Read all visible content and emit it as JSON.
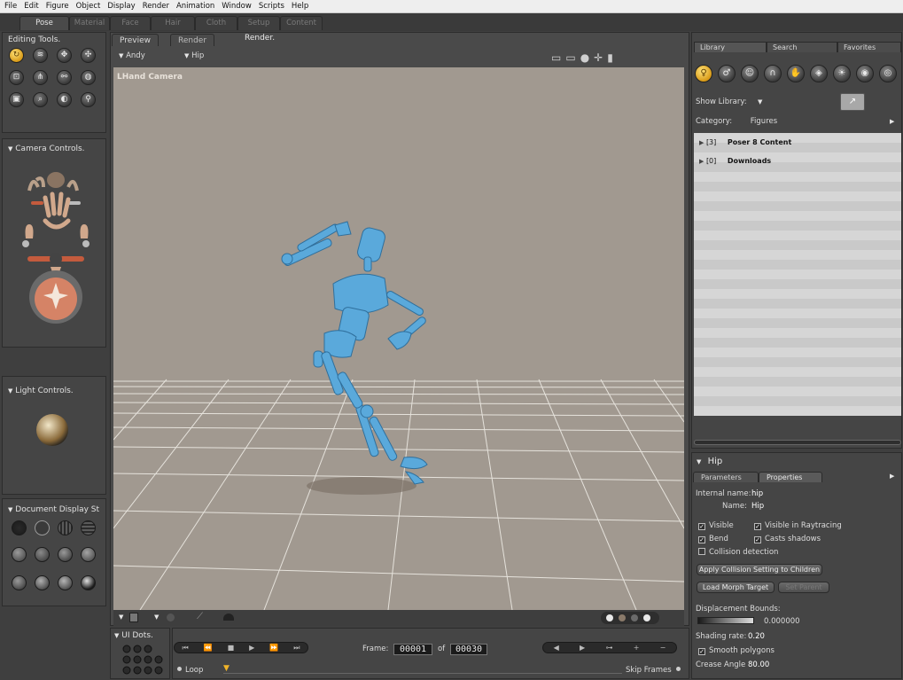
{
  "menu": [
    "File",
    "Edit",
    "Figure",
    "Object",
    "Display",
    "Render",
    "Animation",
    "Window",
    "Scripts",
    "Help"
  ],
  "room_tabs": [
    {
      "label": "Pose",
      "active": true
    },
    {
      "label": "Material",
      "active": false
    },
    {
      "label": "Face",
      "active": false
    },
    {
      "label": "Hair",
      "active": false
    },
    {
      "label": "Cloth",
      "active": false
    },
    {
      "label": "Setup",
      "active": false
    },
    {
      "label": "Content",
      "active": false
    }
  ],
  "left": {
    "editing_title": "Editing Tools.",
    "camera_title": "Camera Controls.",
    "light_title": "Light Controls.",
    "document_title": "Document Display St"
  },
  "doc": {
    "tabs": {
      "preview": "Preview",
      "render": "Render",
      "render_btn": "Render."
    },
    "figure_select": "Andy",
    "actor_select": "Hip",
    "camera_label": "LHand Camera"
  },
  "bottom": {
    "ui_dots": "UI Dots.",
    "frame_label": "Frame:",
    "frame_value": "00001",
    "of_label": "of",
    "total_frames": "00030",
    "loop_label": "Loop",
    "skip_label": "Skip Frames"
  },
  "library": {
    "tabs": [
      "Library",
      "Search",
      "Favorites"
    ],
    "show_label": "Show Library:",
    "category_label": "Category:",
    "category_value": "Figures",
    "items": [
      {
        "count": "[3]",
        "name": "Poser 8 Content"
      },
      {
        "count": "[0]",
        "name": "Downloads"
      }
    ]
  },
  "params": {
    "title": "Hip",
    "tabs": [
      "Parameters",
      "Properties"
    ],
    "internal_name_label": "Internal name:",
    "internal_name": "hip",
    "name_label": "Name:",
    "name": "Hip",
    "visible": "Visible",
    "visible_raytracing": "Visible in Raytracing",
    "bend": "Bend",
    "casts_shadows": "Casts shadows",
    "collision": "Collision detection",
    "apply_btn": "Apply Collision Setting to Children",
    "load_morph_btn": "Load Morph Target",
    "set_parent_btn": "Set Parent",
    "displacement_label": "Displacement Bounds:",
    "displacement_value": "0.000000",
    "shading_label": "Shading rate:",
    "shading_value": "0.20",
    "smooth": "Smooth polygons",
    "crease_label": "Crease Angle",
    "crease_value": "80.00"
  },
  "icons": {
    "editing": [
      "rotate-icon",
      "twist-icon",
      "translate-icon",
      "translate-in-out-icon",
      "scale-icon",
      "taper-icon",
      "chain-break-icon",
      "color-icon",
      "grouping-icon",
      "view-magnifier-icon",
      "morphing-icon",
      "direct-manipulation-icon"
    ],
    "library": [
      "figures-icon",
      "poses-icon",
      "expression-icon",
      "hair-icon",
      "hands-icon",
      "props-icon",
      "lights-icon",
      "cameras-icon",
      "materials-icon"
    ]
  },
  "colors": {
    "accent": "#f0b429",
    "viewport_bg": "#a19990",
    "figure": "#4fa3d6"
  }
}
